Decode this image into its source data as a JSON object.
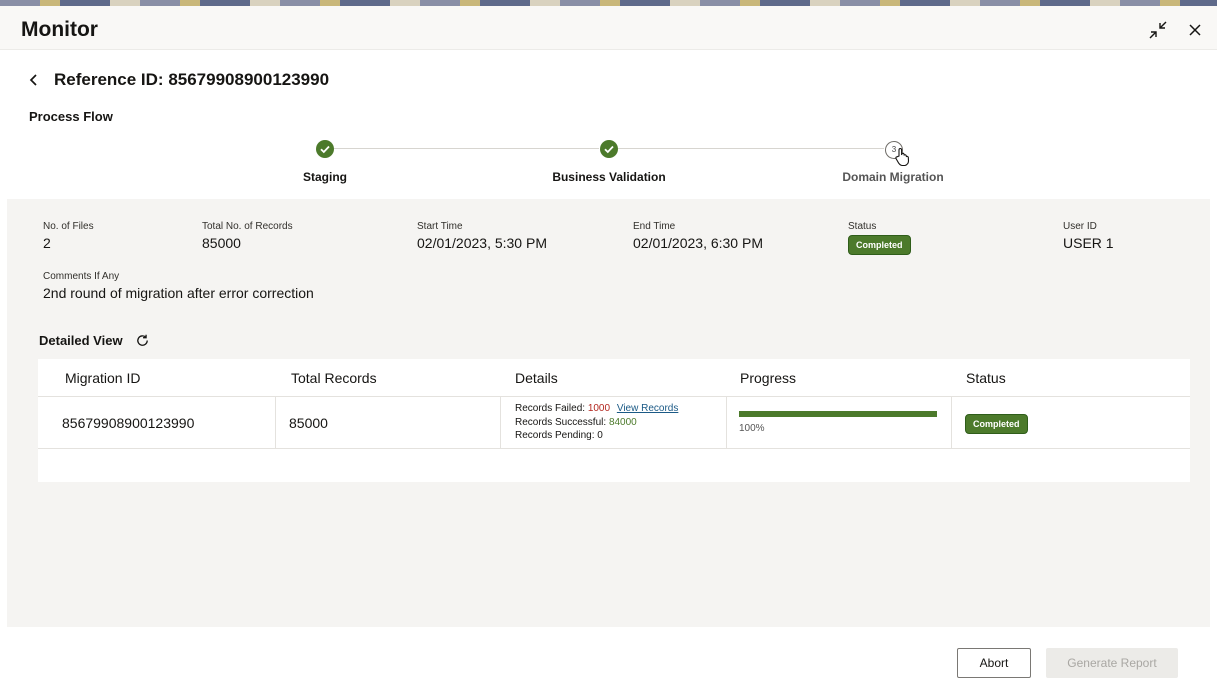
{
  "window": {
    "title": "Monitor",
    "minimize_icon": "collapse-icon",
    "close_icon": "close-icon"
  },
  "reference": {
    "title": "Reference ID: 85679908900123990"
  },
  "process_flow": {
    "title": "Process Flow",
    "steps": [
      {
        "label": "Staging",
        "state": "done"
      },
      {
        "label": "Business Validation",
        "state": "done"
      },
      {
        "label": "Domain Migration",
        "state": "pending",
        "number": "3"
      }
    ]
  },
  "summary": {
    "files_label": "No. of Files",
    "files_value": "2",
    "records_label": "Total No. of Records",
    "records_value": "85000",
    "start_label": "Start Time",
    "start_value": "02/01/2023, 5:30 PM",
    "end_label": "End Time",
    "end_value": "02/01/2023, 6:30 PM",
    "status_label": "Status",
    "status_value": "Completed",
    "user_label": "User ID",
    "user_value": "USER 1",
    "comments_label": "Comments If Any",
    "comments_value": "2nd round of migration after error correction"
  },
  "detailed_view": {
    "title": "Detailed View",
    "columns": [
      "Migration ID",
      "Total Records",
      "Details",
      "Progress",
      "Status"
    ],
    "rows": [
      {
        "migration_id": "85679908900123990",
        "total_records": "85000",
        "failed_label": "Records Failed:",
        "failed_value": "1000",
        "view_link": "View Records",
        "success_label": "Records Successful:",
        "success_value": "84000",
        "pending_label": "Records Pending:",
        "pending_value": "0",
        "progress_percent": 100,
        "progress_text": "100%",
        "status": "Completed"
      }
    ]
  },
  "actions": {
    "abort": "Abort",
    "generate_report": "Generate Report"
  },
  "colors": {
    "success": "#4c7a2b",
    "failed": "#b3261e",
    "link": "#1b5a86"
  }
}
